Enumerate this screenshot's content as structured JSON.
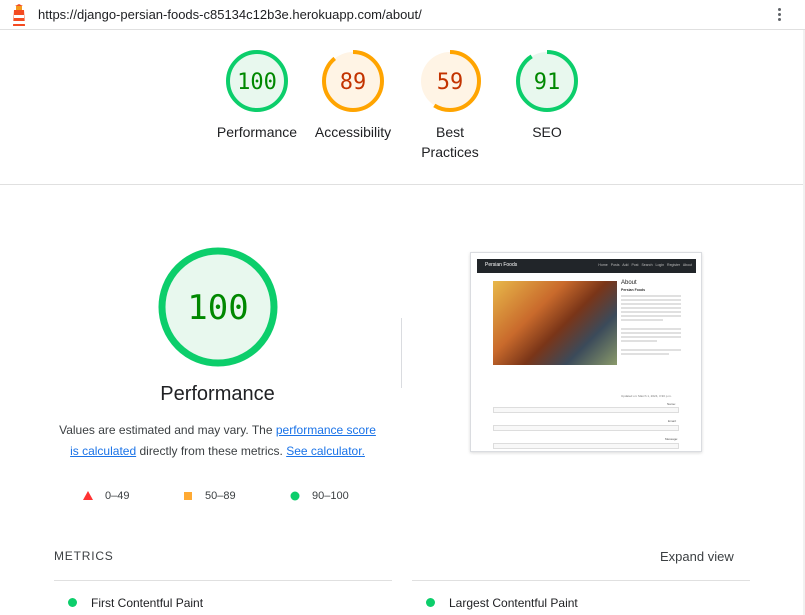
{
  "browser": {
    "url": "https://django-persian-foods-c85134c12b3e.herokuapp.com/about/"
  },
  "scores": [
    {
      "value": "100",
      "label": "Performance",
      "level": "pass",
      "fraction": 1.0
    },
    {
      "value": "89",
      "label": "Accessibility",
      "level": "average",
      "fraction": 0.89
    },
    {
      "value": "59",
      "label": "Best Practices",
      "level": "average",
      "fraction": 0.59
    },
    {
      "value": "91",
      "label": "SEO",
      "level": "pass",
      "fraction": 0.91
    }
  ],
  "performance": {
    "score": "100",
    "title": "Performance",
    "desc_1": "Values are estimated and may vary. The ",
    "link_score": "performance score is calculated",
    "desc_2": " directly from these metrics. ",
    "link_calc": "See calculator."
  },
  "legend": [
    {
      "range": "0–49",
      "shape": "triangle",
      "color": "#ff3333"
    },
    {
      "range": "50–89",
      "shape": "square",
      "color": "#ffaa33"
    },
    {
      "range": "90–100",
      "shape": "circle",
      "color": "#0cce6b"
    }
  ],
  "thumbnail": {
    "brand": "Persian Foods",
    "nav": "Home  Posts  Add Post  Search  Login  Register  About",
    "heading": "About",
    "subheading": "Persian Foods",
    "updated": "Updated on: March 1, 2024, 3:30 p.m.",
    "name_label": "Name:",
    "email_label": "Email:",
    "message_label": "Message:"
  },
  "metrics": {
    "heading": "METRICS",
    "expand_label": "Expand view",
    "items": [
      {
        "label": "First Contentful Paint",
        "color": "#0cce6b"
      },
      {
        "label": "Largest Contentful Paint",
        "color": "#0cce6b"
      }
    ]
  },
  "colors": {
    "pass": "#0cce6b",
    "pass_text": "#008800",
    "pass_fill": "#e8f8ee",
    "average": "#ffa400",
    "average_text": "#c33300",
    "average_fill": "#fff4e5",
    "link": "#1a73e8"
  }
}
